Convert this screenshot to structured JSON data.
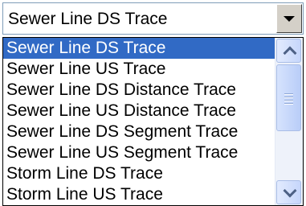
{
  "combo": {
    "selected_value": "Sewer Line DS Trace",
    "icon": "chevron-down-icon"
  },
  "dropdown": {
    "selected_index": 0,
    "items": [
      "Sewer Line DS Trace",
      "Sewer Line US Trace",
      "Sewer Line DS Distance Trace",
      "Sewer Line US Distance Trace",
      "Sewer Line DS Segment Trace",
      "Sewer Line US Segment Trace",
      "Storm Line DS Trace",
      "Storm Line US Trace"
    ],
    "scrollbar": {
      "up_icon": "chevron-up-icon",
      "down_icon": "chevron-down-icon",
      "position": 0
    }
  },
  "colors": {
    "selection": "#316ac5",
    "selection_text": "#ffffff",
    "combo_border": "#7f9db9",
    "scrollbar_track": "#eef2fa"
  }
}
